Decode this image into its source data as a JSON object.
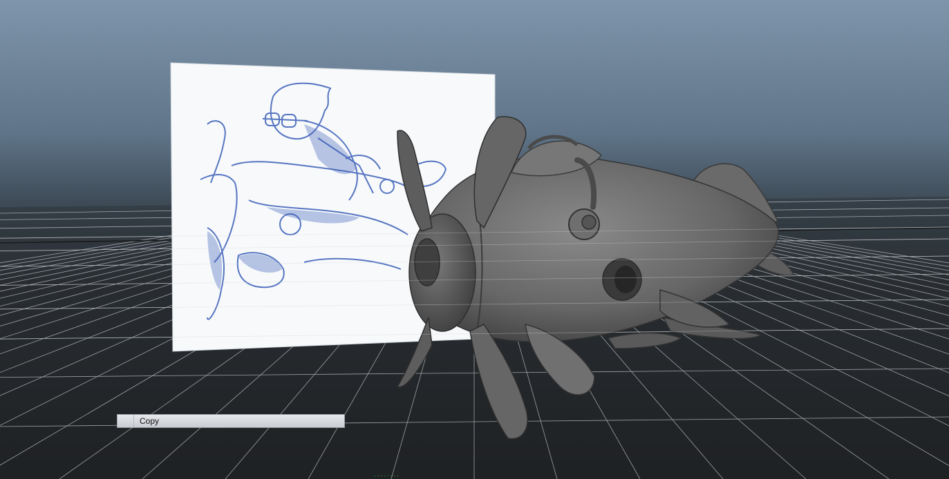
{
  "viewport": {
    "name": "3d-perspective-viewport"
  },
  "scene": {
    "reference_image": "character-sketch-image-plane",
    "model": "propeller-fish-plane-model"
  },
  "context_menu": {
    "items": [
      {
        "label": "Copy"
      }
    ]
  },
  "hud": {
    "frame_label": "........"
  },
  "colors": {
    "sky_top": "#7f95ab",
    "horizon": "#3f4c58",
    "ground": "#1c1e20",
    "grid": "#c8ccd0",
    "model": "#6b6b6b",
    "sketch_blue": "#3b5fb8"
  }
}
